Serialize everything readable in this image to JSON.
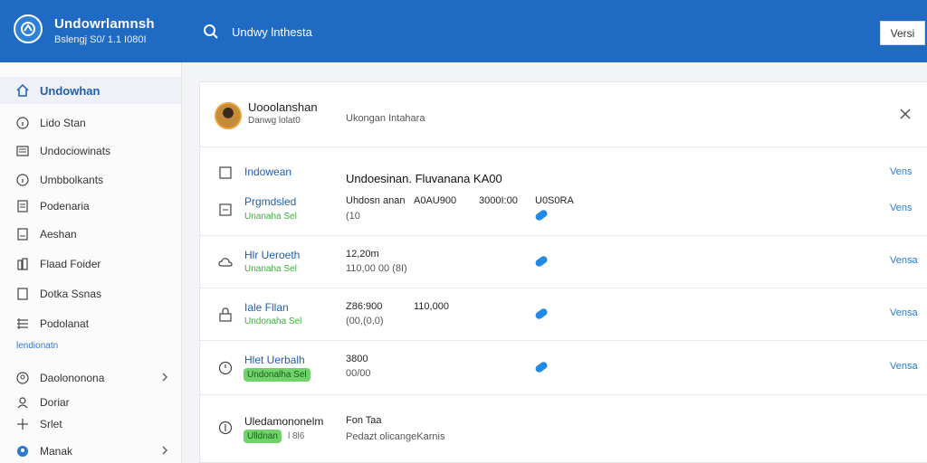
{
  "header": {
    "title": "Undowrlamnsh",
    "subtitle": "Bslengj S0/ 1.1 I080I",
    "search_text": "Undwy lnthesta",
    "button_label": "Versi"
  },
  "sidebar": {
    "items": [
      {
        "label": "Undowhan",
        "icon": "home-icon"
      },
      {
        "label": "Lido Stan",
        "icon": "info-icon"
      },
      {
        "label": "Undociowinats",
        "icon": "list-icon"
      },
      {
        "label": "Umbbolkants",
        "icon": "info-icon"
      },
      {
        "label": "Podenaria",
        "icon": "document-icon"
      },
      {
        "label": "Aeshan",
        "icon": "document-icon"
      },
      {
        "label": "Flaad Foider",
        "icon": "building-icon"
      },
      {
        "label": "Dotka Ssnas",
        "icon": "square-icon"
      },
      {
        "label": "Podolanat",
        "icon": "grid-icon"
      },
      {
        "label": "Daolononona",
        "icon": "people-icon"
      },
      {
        "label": "Doriar",
        "icon": "person-icon"
      },
      {
        "label": "Srlet",
        "icon": "move-icon"
      },
      {
        "label": "Manak",
        "icon": "location-icon"
      }
    ],
    "section_label": "lendionatn"
  },
  "panel": {
    "user_name": "Uooolanshan",
    "user_sub": "Danwg lolat0",
    "user_mid": "Ukongan Intahara",
    "header_row": {
      "name": "Indowean",
      "title": "Undoesinan.  Fluvanana KA00",
      "link": "Vens"
    },
    "rows": [
      {
        "name": "Prgmdsled",
        "tag": "Unanaha Sel",
        "v1": "Uhdosn anan",
        "v2": "A0AU900",
        "v3": "3000I:00",
        "v4": "U0S0RA",
        "sub1": "(10",
        "link": "Vens",
        "icon": "square-icon"
      },
      {
        "name": "Hlr Ueroeth",
        "tag": "Unanaha Sel",
        "v1": "12,20m",
        "sub1": "110,00 00 (8I)",
        "link": "Vensa",
        "icon": "cloud-icon"
      },
      {
        "name": "Iale Fllan",
        "tag": "Undonaha Sel",
        "v1": "Z86:900",
        "v2": "110,000",
        "sub1": "(00,(0,0)",
        "link": "Vensa",
        "icon": "lock-icon"
      },
      {
        "name": "Hlet Uerbalh",
        "tag": "Undonalha Sel",
        "v1": "3800",
        "sub1": "00/00",
        "link": "Vensa",
        "icon": "clock-icon"
      },
      {
        "name": "Uledamononelm",
        "tag": "Ulldnan",
        "extra": "l 8l6",
        "v1": "Fon Taa",
        "sub1": "Pedazt olicangeKarnis",
        "icon": "circle-icon"
      }
    ]
  },
  "colors": {
    "accent": "#1f6bc4",
    "link": "#2a7ad0",
    "tag": "#3bae3b",
    "pill": "#6fd36a",
    "status": "#1f8ae8"
  }
}
